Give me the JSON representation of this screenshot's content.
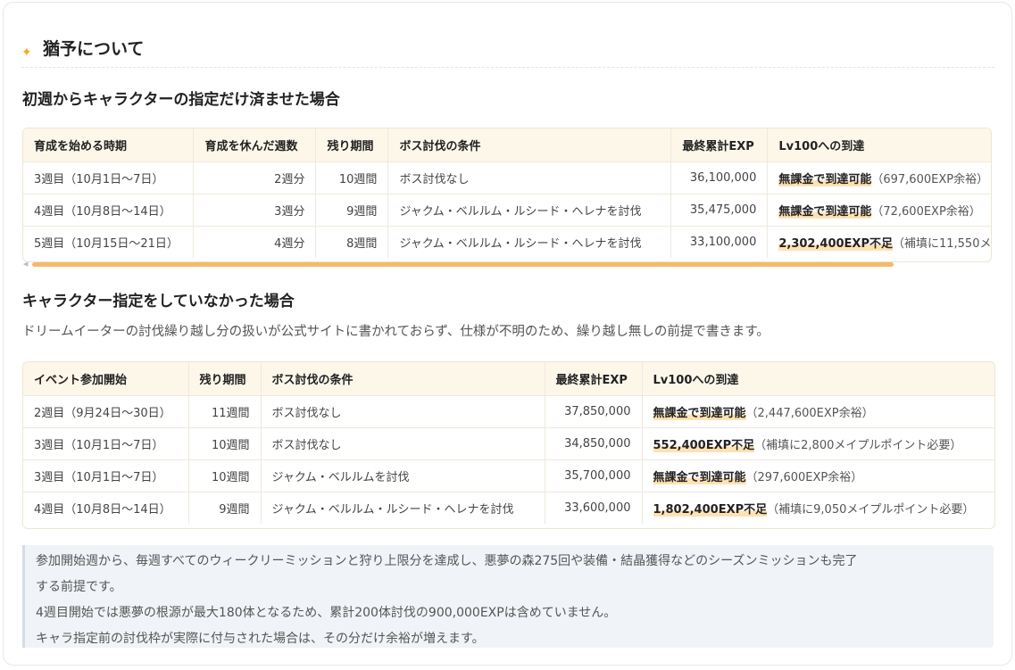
{
  "section_title": "猶予について",
  "case1": {
    "heading": "初週からキャラクターの指定だけ済ませた場合",
    "headers": [
      "育成を始める時期",
      "育成を休んだ週数",
      "残り期間",
      "ボス討伐の条件",
      "最終累計EXP",
      "Lv100への到達"
    ],
    "rows": [
      {
        "start": "3週目（10月1日〜7日）",
        "rest": "2週分",
        "remain": "10週間",
        "boss": "ボス討伐なし",
        "exp": "36,100,000",
        "reach": "無課金で到達可能",
        "note": "（697,600EXP余裕）"
      },
      {
        "start": "4週目（10月8日〜14日）",
        "rest": "3週分",
        "remain": "9週間",
        "boss": "ジャクム・ベルルム・ルシード・ヘレナを討伐",
        "exp": "35,475,000",
        "reach": "無課金で到達可能",
        "note": "（72,600EXP余裕）"
      },
      {
        "start": "5週目（10月15日〜21日）",
        "rest": "4週分",
        "remain": "8週間",
        "boss": "ジャクム・ベルルム・ルシード・ヘレナを討伐",
        "exp": "33,100,000",
        "reach": "2,302,400EXP不足",
        "note": "（補填に11,550メ"
      }
    ]
  },
  "case2": {
    "heading": "キャラクター指定をしていなかった場合",
    "description": "ドリームイーターの討伐繰り越し分の扱いが公式サイトに書かれておらず、仕様が不明のため、繰り越し無しの前提で書きます。",
    "headers": [
      "イベント参加開始",
      "残り期間",
      "ボス討伐の条件",
      "最終累計EXP",
      "Lv100への到達"
    ],
    "rows": [
      {
        "start": "2週目（9月24日〜30日）",
        "remain": "11週間",
        "boss": "ボス討伐なし",
        "exp": "37,850,000",
        "reach": "無課金で到達可能",
        "note": "（2,447,600EXP余裕）"
      },
      {
        "start": "3週目（10月1日〜7日）",
        "remain": "10週間",
        "boss": "ボス討伐なし",
        "exp": "34,850,000",
        "reach": "552,400EXP不足",
        "note": "（補填に2,800メイプルポイント必要）"
      },
      {
        "start": "3週目（10月1日〜7日）",
        "remain": "10週間",
        "boss": "ジャクム・ベルルムを討伐",
        "exp": "35,700,000",
        "reach": "無課金で到達可能",
        "note": "（297,600EXP余裕）"
      },
      {
        "start": "4週目（10月8日〜14日）",
        "remain": "9週間",
        "boss": "ジャクム・ベルルム・ルシード・ヘレナを討伐",
        "exp": "33,600,000",
        "reach": "1,802,400EXP不足",
        "note": "（補填に9,050メイプルポイント必要）"
      }
    ]
  },
  "callout": {
    "line1": "参加開始週から、毎週すべてのウィークリーミッションと狩り上限分を達成し、悪夢の森275回や装備・結晶獲得などのシーズンミッションも完了",
    "line2": "する前提です。",
    "line3": "4週目開始では悪夢の根源が最大180体となるため、累計200体討伐の900,000EXPは含めていません。",
    "line4": "キャラ指定前の討伐枠が実際に付与された場合は、その分だけ余裕が増えます。"
  },
  "colors": {
    "accent": "#f5a623",
    "highlight": "#fde2b3",
    "scroll_thumb": "#f6b96b",
    "table_header_bg": "#fdf7ea"
  },
  "icons": {
    "section": "sparkle-icon"
  }
}
